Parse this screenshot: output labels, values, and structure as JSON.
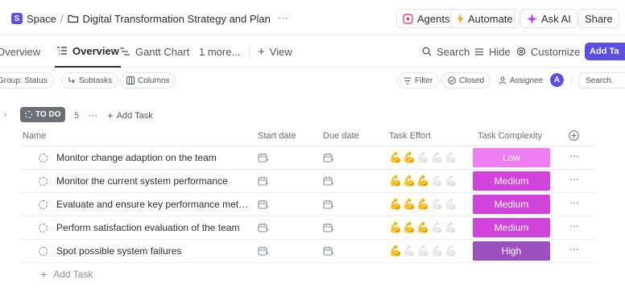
{
  "breadcrumb": {
    "space_badge": "S",
    "space": "Space",
    "separator": "/",
    "list_title": "Digital Transformation Strategy and Plan",
    "more": "⋯"
  },
  "top_actions": {
    "agents": "Agents",
    "automate": "Automate",
    "ask_ai": "Ask AI",
    "share": "Share"
  },
  "tabs": [
    {
      "label": "Overview"
    },
    {
      "label": "Overview"
    },
    {
      "label": "Gantt Chart"
    },
    {
      "label": "1 more..."
    },
    {
      "label": "View"
    }
  ],
  "toolbar": {
    "search": "Search",
    "hide": "Hide",
    "customize": "Customize",
    "add_task": "Add Ta"
  },
  "filters": {
    "group": "Group: Status",
    "subtasks": "Subtasks",
    "columns": "Columns",
    "filter": "Filter",
    "closed": "Closed",
    "assignee": "Assignee",
    "avatar": "A",
    "search": "Search."
  },
  "group": {
    "status": "TO DO",
    "count": "5",
    "more": "⋯",
    "add_task": "Add Task"
  },
  "columns": {
    "name": "Name",
    "start_date": "Start date",
    "due_date": "Due date",
    "effort": "Task Effort",
    "complexity": "Task Complexity"
  },
  "tasks": [
    {
      "name": "Monitor change adaption on the team",
      "effort": 2,
      "complexity": "Low",
      "complexity_color": "#f07ef3"
    },
    {
      "name": "Monitor the current system performance",
      "effort": 3,
      "complexity": "Medium",
      "complexity_color": "#d044db"
    },
    {
      "name": "Evaluate and ensure key performance metri...",
      "effort": 3,
      "complexity": "Medium",
      "complexity_color": "#d044db"
    },
    {
      "name": "Perform satisfaction evaluation of the team",
      "effort": 3,
      "complexity": "Medium",
      "complexity_color": "#d044db"
    },
    {
      "name": "Spot possible system failures",
      "effort": 1,
      "complexity": "High",
      "complexity_color": "#9c4fbf"
    }
  ],
  "effort_max": 5,
  "effort_icon": "💪",
  "row_more": "⋯",
  "add_task_bottom": "Add Task",
  "colors": {
    "accent": "#5b4fe6",
    "status_badge": "#6b6f76"
  }
}
